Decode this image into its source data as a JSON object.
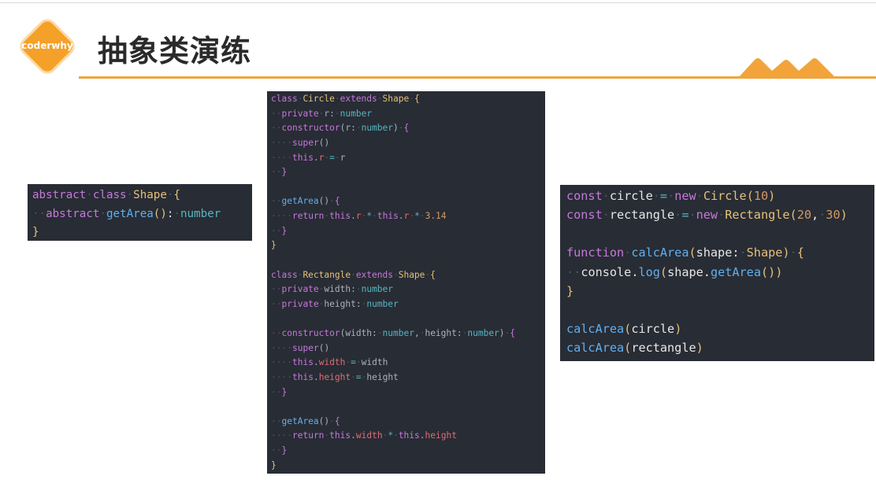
{
  "header": {
    "logo_text": "coderwhy",
    "title": "抽象类演练"
  },
  "colors": {
    "accent": "#f2a43a",
    "code_background": "#282c34"
  },
  "code_blocks": [
    {
      "name": "abstract-shape-class",
      "lines": [
        "abstract class Shape {",
        "  abstract getArea(): number",
        "}"
      ]
    },
    {
      "name": "circle-rectangle-classes",
      "lines": [
        "class Circle extends Shape {",
        "  private r: number",
        "  constructor(r: number) {",
        "    super()",
        "    this.r = r",
        "  }",
        "",
        "  getArea() {",
        "    return this.r * this.r * 3.14",
        "  }",
        "}",
        "",
        "class Rectangle extends Shape {",
        "  private width: number",
        "  private height: number",
        "",
        "  constructor(width: number, height: number) {",
        "    super()",
        "    this.width = width",
        "    this.height = height",
        "  }",
        "",
        "  getArea() {",
        "    return this.width * this.height",
        "  }",
        "}"
      ]
    },
    {
      "name": "calc-area-usage",
      "lines": [
        "const circle = new Circle(10)",
        "const rectangle = new Rectangle(20, 30)",
        "",
        "function calcArea(shape: Shape) {",
        "  console.log(shape.getArea())",
        "}",
        "",
        "calcArea(circle)",
        "calcArea(rectangle)"
      ]
    }
  ]
}
